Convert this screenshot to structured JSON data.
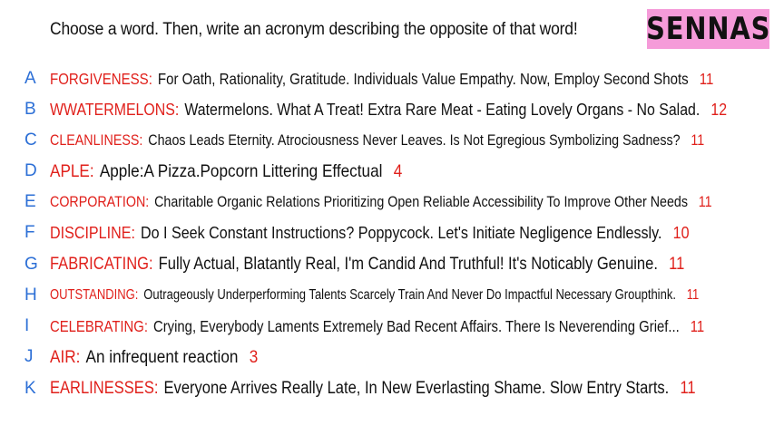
{
  "header": {
    "prompt": "Choose a word. Then, write an acronym describing the opposite of that word!",
    "logo": "SENNAS"
  },
  "entries": [
    {
      "letter": "A",
      "word": "FORGIVENESS:",
      "acronym": "For Oath, Rationality, Gratitude. Individuals Value Empathy. Now, Employ Second Shots",
      "count": "11"
    },
    {
      "letter": "B",
      "word": "WWATERMELONS:",
      "acronym": "Watermelons. What A Treat! Extra Rare Meat - Eating Lovely Organs - No Salad.",
      "count": "12"
    },
    {
      "letter": "C",
      "word": "CLEANLINESS:",
      "acronym": "Chaos Leads Eternity. Atrociousness Never Leaves. Is Not Egregious Symbolizing Sadness?",
      "count": "11"
    },
    {
      "letter": "D",
      "word": "APLE:",
      "acronym": "Apple:A Pizza.Popcorn Littering Effectual",
      "count": "4"
    },
    {
      "letter": "E",
      "word": "CORPORATION:",
      "acronym": "Charitable Organic Relations Prioritizing Open Reliable Accessibility To Improve Other Needs",
      "count": "11"
    },
    {
      "letter": "F",
      "word": "DISCIPLINE:",
      "acronym": "Do I Seek Constant Instructions? Poppycock. Let's Initiate Negligence Endlessly.",
      "count": "10"
    },
    {
      "letter": "G",
      "word": "FABRICATING:",
      "acronym": "Fully Actual, Blatantly Real, I'm Candid And Truthful! It's Noticably Genuine.",
      "count": "11"
    },
    {
      "letter": "H",
      "word": "OUTSTANDING:",
      "acronym": "Outrageously Underperforming Talents Scarcely Train And Never Do Impactful Necessary Groupthink.",
      "count": "11"
    },
    {
      "letter": "I",
      "word": "CELEBRATING:",
      "acronym": "Crying, Everybody Laments Extremely Bad Recent Affairs. There Is Neverending Grief...",
      "count": "11"
    },
    {
      "letter": "J",
      "word": "AIR:",
      "acronym": "An infrequent reaction",
      "count": "3"
    },
    {
      "letter": "K",
      "word": "EARLINESSES:",
      "acronym": "Everyone Arrives Really Late, In New Everlasting Shame. Slow Entry Starts.",
      "count": "11"
    }
  ]
}
